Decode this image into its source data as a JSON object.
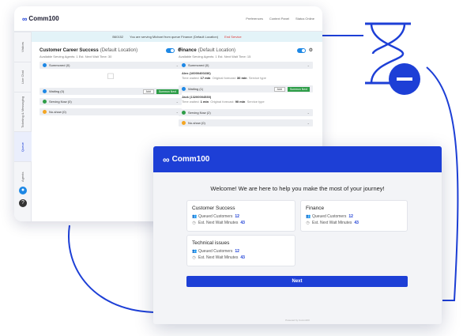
{
  "back_window": {
    "logo": {
      "mark": "∞",
      "text": "Comm100"
    },
    "header_links": [
      "Preferences",
      "Context Panel",
      "Status Online"
    ],
    "sidebar_tabs": [
      "Visitors",
      "Live Chat",
      "Ticketing & Messaging",
      "Queue",
      "Agents"
    ],
    "banner": {
      "id": "B60152",
      "text": "You are serving Michael from queue Finance (Default Location)",
      "end_label": "End Service"
    },
    "panels": [
      {
        "title": "Customer Career Success",
        "location": "(Default Location)",
        "sub": "Available Serving Agents: 1   Est. Next Wait Time: 30",
        "rows": [
          {
            "label": "Summoned (0)",
            "color": "#1e88e5",
            "add": "",
            "btn": ""
          },
          {
            "label": "Waiting (0)",
            "color": "#1e88e5",
            "add": "Add",
            "btn": "Summon Next"
          },
          {
            "label": "Serving Now (0)",
            "color": "#2e9d48",
            "add": "",
            "btn": ""
          },
          {
            "label": "No-show (0)",
            "color": "#f5a623",
            "add": "",
            "btn": ""
          }
        ]
      },
      {
        "title": "Finance",
        "location": "(Default Location)",
        "sub": "Available Serving Agents: 1   Est. Next Wait Time: 15",
        "rows": [
          {
            "label": "Summoned (0)",
            "color": "#1e88e5",
            "add": "",
            "btn": ""
          },
          {
            "label": "Waiting (1)",
            "color": "#1e88e5",
            "add": "Add",
            "btn": "Summon Next"
          },
          {
            "label": "Serving Now (2)",
            "color": "#2e9d48",
            "add": "",
            "btn": ""
          },
          {
            "label": "No-show (0)",
            "color": "#f5a623",
            "add": "",
            "btn": ""
          }
        ],
        "customers": [
          {
            "name": "Alex (16000400236)",
            "meta_label": "Time waited:",
            "meta_value": "17 min",
            "meta2_label": "Original forecast:",
            "meta2_value": "30 min",
            "meta3": "Service type"
          },
          {
            "name": "Jack (13200004530)",
            "meta_label": "Time waited:",
            "meta_value": "1 min",
            "meta2_label": "Original forecast:",
            "meta2_value": "90 min",
            "meta3": "Service type"
          }
        ]
      }
    ]
  },
  "front_window": {
    "logo": {
      "mark": "∞",
      "text": "Comm100"
    },
    "welcome": "Welcome! We are here to help you make the most of your journey!",
    "cards": [
      {
        "title": "Customer Success",
        "queued_label": "Queued Customers",
        "queued": "12",
        "wait_label": "Est. Next Wait Minutes",
        "wait": "43"
      },
      {
        "title": "Finance",
        "queued_label": "Queued Customers",
        "queued": "12",
        "wait_label": "Est. Next Wait Minutes",
        "wait": "43"
      },
      {
        "title": "Technical issues",
        "queued_label": "Queued Customers",
        "queued": "12",
        "wait_label": "Est. Next Wait Minutes",
        "wait": "43"
      }
    ],
    "next_button": "Next",
    "powered": "Powered by Comm100"
  },
  "colors": {
    "brand": "#1d3fd6",
    "green": "#2e9d48",
    "accent_blue": "#1e88e5"
  }
}
